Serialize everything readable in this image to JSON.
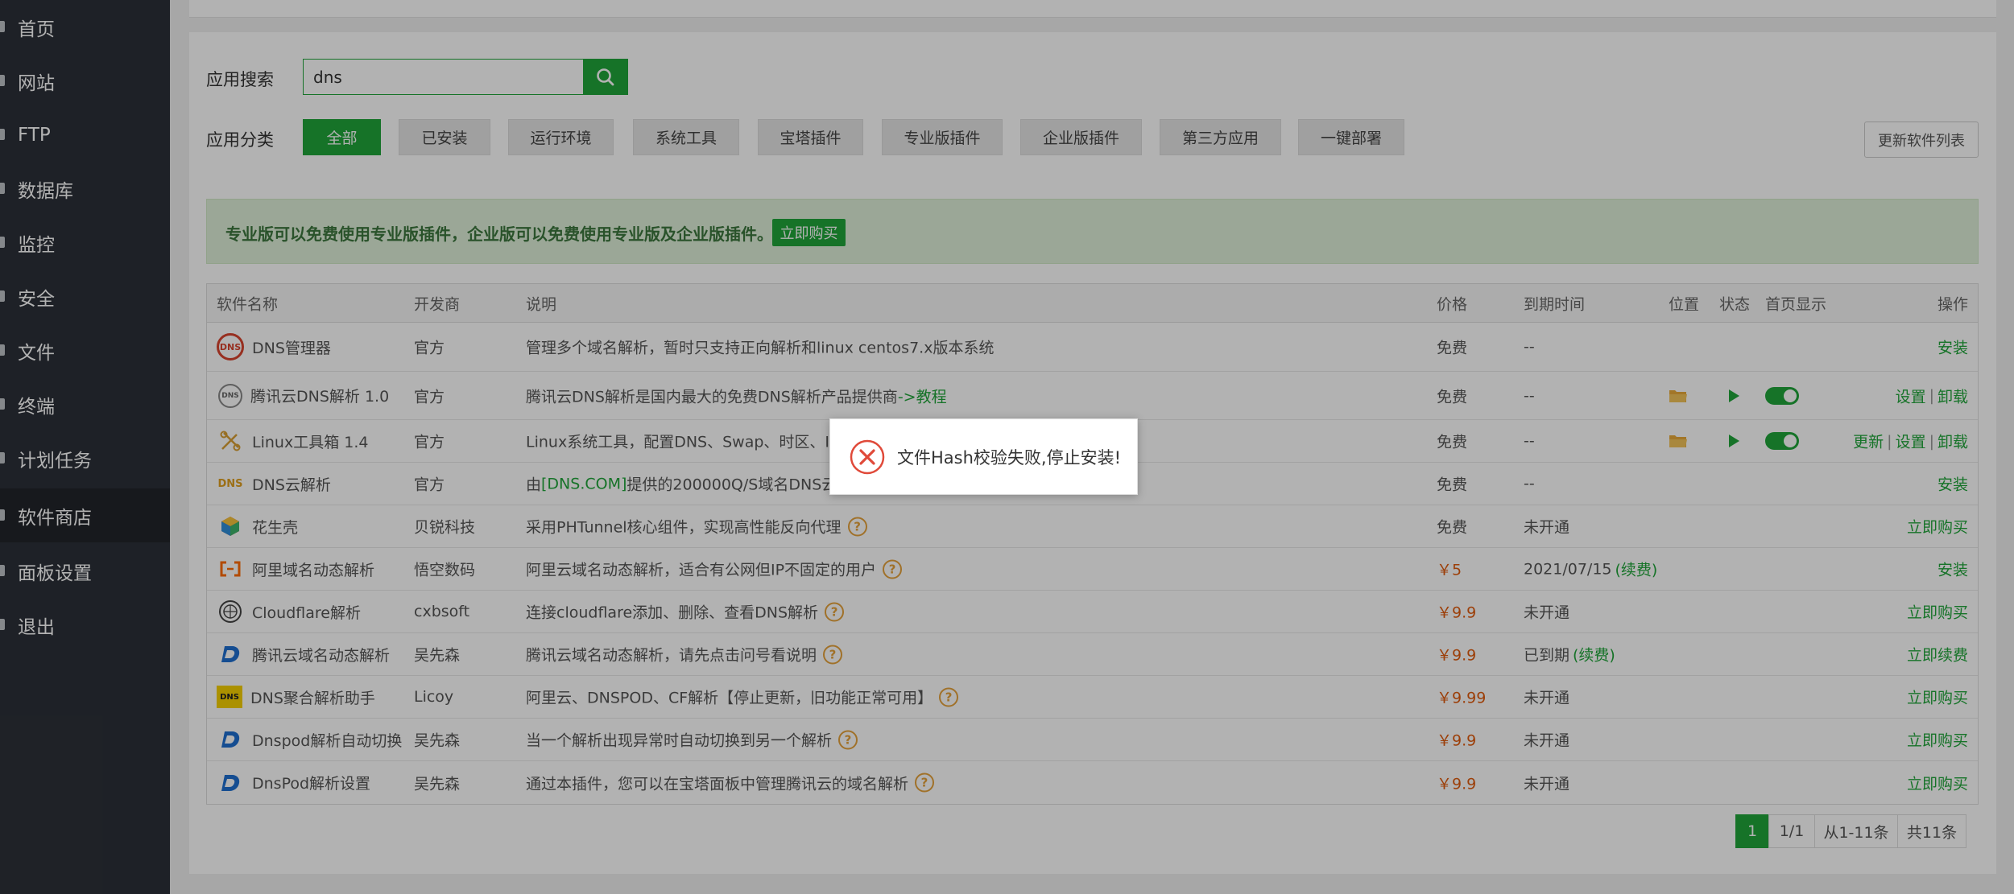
{
  "sidebar": {
    "items": [
      {
        "label": "首页"
      },
      {
        "label": "网站"
      },
      {
        "label": "FTP"
      },
      {
        "label": "数据库"
      },
      {
        "label": "监控"
      },
      {
        "label": "安全"
      },
      {
        "label": "文件"
      },
      {
        "label": "终端"
      },
      {
        "label": "计划任务"
      },
      {
        "label": "软件商店",
        "active": true
      },
      {
        "label": "面板设置"
      },
      {
        "label": "退出"
      }
    ]
  },
  "search": {
    "label": "应用搜索",
    "value": "dns"
  },
  "categories": {
    "label": "应用分类",
    "items": [
      "全部",
      "已安装",
      "运行环境",
      "系统工具",
      "宝塔插件",
      "专业版插件",
      "企业版插件",
      "第三方应用",
      "一键部署"
    ],
    "refresh_label": "更新软件列表"
  },
  "notice": {
    "text": "专业版可以免费使用专业版插件，企业版可以免费使用专业版及企业版插件。",
    "buy_label": "立即购买"
  },
  "table": {
    "headers": {
      "name": "软件名称",
      "dev": "开发商",
      "desc": "说明",
      "price": "价格",
      "expire": "到期时间",
      "position": "位置",
      "status": "状态",
      "home": "首页显示",
      "ops": "操作"
    },
    "rows": [
      {
        "name": "DNS管理器",
        "dev": "官方",
        "desc": "管理多个域名解析，暂时只支持正向解析和linux centos7.x版本系统",
        "price": "免费",
        "expire": "--",
        "ops": [
          "安装"
        ]
      },
      {
        "name": "腾讯云DNS解析 1.0",
        "dev": "官方",
        "desc": "腾讯云DNS解析是国内最大的免费DNS解析产品提供商",
        "desc_link": "->教程",
        "price": "免费",
        "expire": "--",
        "ops": [
          "设置",
          "卸载"
        ]
      },
      {
        "name": "Linux工具箱 1.4",
        "dev": "官方",
        "desc": "Linux系统工具，配置DNS、Swap、时区、IP配",
        "price": "免费",
        "expire": "--",
        "ops": [
          "更新",
          "设置",
          "卸载"
        ]
      },
      {
        "name": "DNS云解析",
        "dev": "官方",
        "desc_pre": "由",
        "desc_link": "[DNS.COM]",
        "desc": "提供的200000Q/S域名DNS云解",
        "price": "免费",
        "expire": "--",
        "ops": [
          "安装"
        ]
      },
      {
        "name": "花生壳",
        "dev": "贝锐科技",
        "desc": "采用PHTunnel核心组件，实现高性能反向代理",
        "price": "免费",
        "expire": "未开通",
        "ops": [
          "立即购买"
        ]
      },
      {
        "name": "阿里域名动态解析",
        "dev": "悟空数码",
        "desc": "阿里云域名动态解析，适合有公网但IP不固定的用户",
        "price": "￥5",
        "expire": "2021/07/15",
        "expire_link": "(续费)",
        "ops": [
          "安装"
        ]
      },
      {
        "name": "Cloudflare解析",
        "dev": "cxbsoft",
        "desc": "连接cloudflare添加、删除、查看DNS解析",
        "price": "￥9.9",
        "expire": "未开通",
        "ops": [
          "立即购买"
        ]
      },
      {
        "name": "腾讯云域名动态解析",
        "dev": "吴先森",
        "desc": "腾讯云域名动态解析，请先点击问号看说明",
        "price": "￥9.9",
        "expire": "已到期",
        "expire_link": "(续费)",
        "ops": [
          "立即续费"
        ]
      },
      {
        "name": "DNS聚合解析助手",
        "dev": "Licoy",
        "desc": "阿里云、DNSPOD、CF解析【停止更新，旧功能正常可用】",
        "price": "￥9.99",
        "expire": "未开通",
        "ops": [
          "立即购买"
        ]
      },
      {
        "name": "Dnspod解析自动切换",
        "dev": "吴先森",
        "desc": "当一个解析出现异常时自动切换到另一个解析",
        "price": "￥9.9",
        "expire": "未开通",
        "ops": [
          "立即购买"
        ]
      },
      {
        "name": "DnsPod解析设置",
        "dev": "吴先森",
        "desc": "通过本插件，您可以在宝塔面板中管理腾讯云的域名解析",
        "price": "￥9.9",
        "expire": "未开通",
        "ops": [
          "立即购买"
        ]
      }
    ]
  },
  "pagination": {
    "current": "1",
    "pages": "1/1",
    "range": "从1-11条",
    "total": "共11条"
  },
  "dialog": {
    "message": "文件Hash校验失败,停止安装!"
  },
  "colors": {
    "accent": "#20a53a",
    "sidebar": "#2c3038",
    "price": "#e05b0d"
  }
}
